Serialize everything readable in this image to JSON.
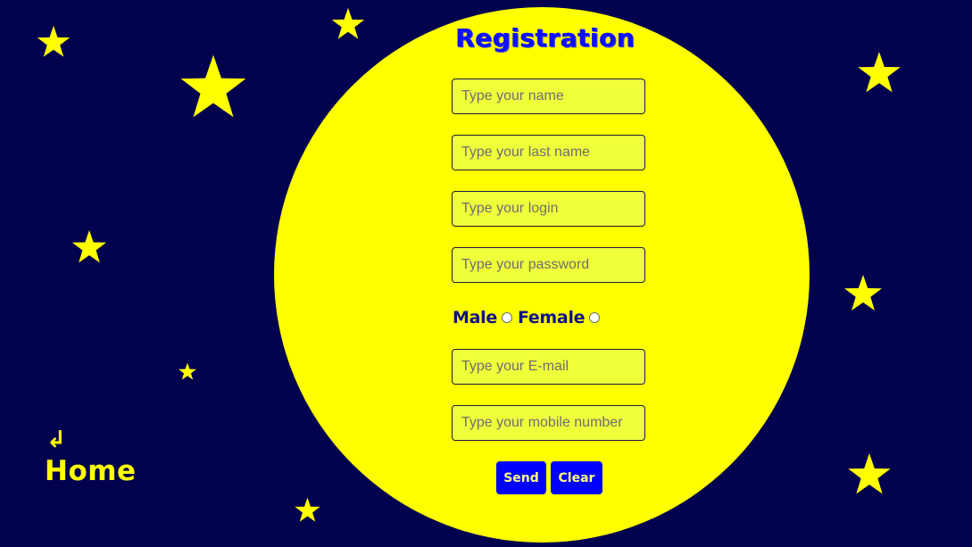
{
  "form": {
    "title": "Registration",
    "fields": {
      "name_placeholder": "Type your name",
      "last_name_placeholder": "Type your last name",
      "login_placeholder": "Type your login",
      "password_placeholder": "Type your password",
      "email_placeholder": "Type your E-mail",
      "mobile_placeholder": "Type your mobile number"
    },
    "gender": {
      "male_label": "Male",
      "female_label": "Female"
    },
    "buttons": {
      "send_label": "Send",
      "clear_label": "Clear"
    }
  },
  "nav": {
    "home_arrow": "↲",
    "home_label": "Home"
  },
  "colors": {
    "background": "#02024e",
    "moon": "#ffff00",
    "star": "#ffff00",
    "title": "#1010ff",
    "button": "#0000ff",
    "button_text": "#ffff7a",
    "field_fill": "#efff3a"
  }
}
